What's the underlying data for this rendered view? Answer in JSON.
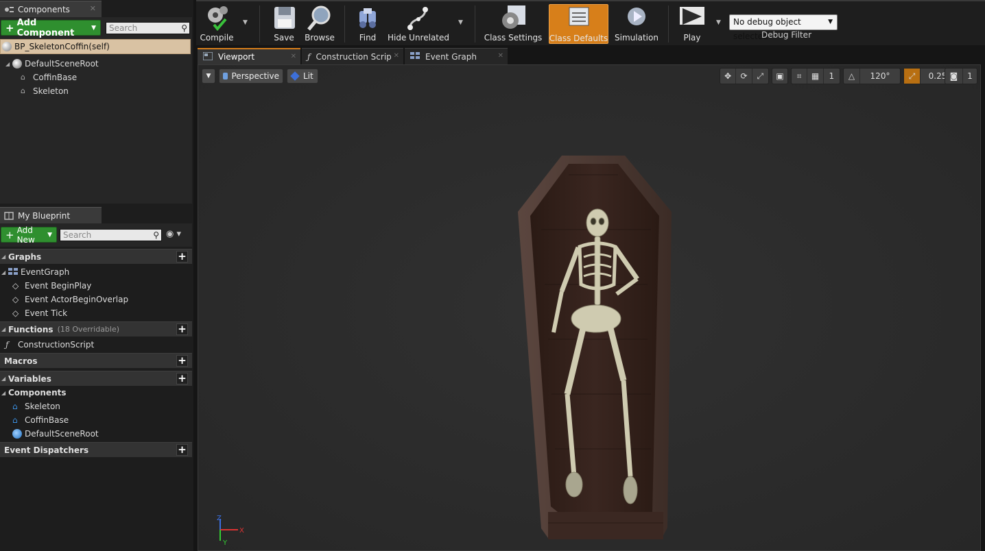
{
  "components_panel": {
    "tab_label": "Components",
    "add_button": "Add Component",
    "search_placeholder": "Search",
    "self_label": "BP_SkeletonCoffin(self)",
    "tree": [
      "DefaultSceneRoot",
      "CoffinBase",
      "Skeleton"
    ]
  },
  "my_blueprint": {
    "tab_label": "My Blueprint",
    "add_button": "Add New",
    "search_placeholder": "Search",
    "graphs": {
      "header": "Graphs",
      "root": "EventGraph",
      "events": [
        "Event BeginPlay",
        "Event ActorBeginOverlap",
        "Event Tick"
      ]
    },
    "functions": {
      "header": "Functions",
      "overridable": "(18 Overridable)",
      "items": [
        "ConstructionScript"
      ]
    },
    "macros_header": "Macros",
    "variables_header": "Variables",
    "components": {
      "header": "Components",
      "items": [
        "Skeleton",
        "CoffinBase",
        "DefaultSceneRoot"
      ]
    },
    "dispatchers_header": "Event Dispatchers"
  },
  "toolbar": {
    "compile": "Compile",
    "save": "Save",
    "browse": "Browse",
    "find": "Find",
    "hide_unrelated": "Hide Unrelated",
    "class_settings": "Class Settings",
    "class_defaults": "Class Defaults",
    "simulation": "Simulation",
    "play": "Play",
    "debug_selected": "No debug object selected",
    "debug_filter_label": "Debug Filter"
  },
  "doc_tabs": [
    "Viewport",
    "Construction Scrip",
    "Event Graph"
  ],
  "viewport": {
    "perspective": "Perspective",
    "lit": "Lit",
    "grid_snap": "1",
    "angle_snap": "120°",
    "scale_snap": "0.25",
    "camera_speed": "1",
    "axis": {
      "z": "Z",
      "x": "X",
      "y": "Y"
    }
  },
  "colors": {
    "accent": "#d77f1a",
    "green": "#2f8f2f",
    "panel": "#262626",
    "viewport": "#2d2d2d"
  }
}
